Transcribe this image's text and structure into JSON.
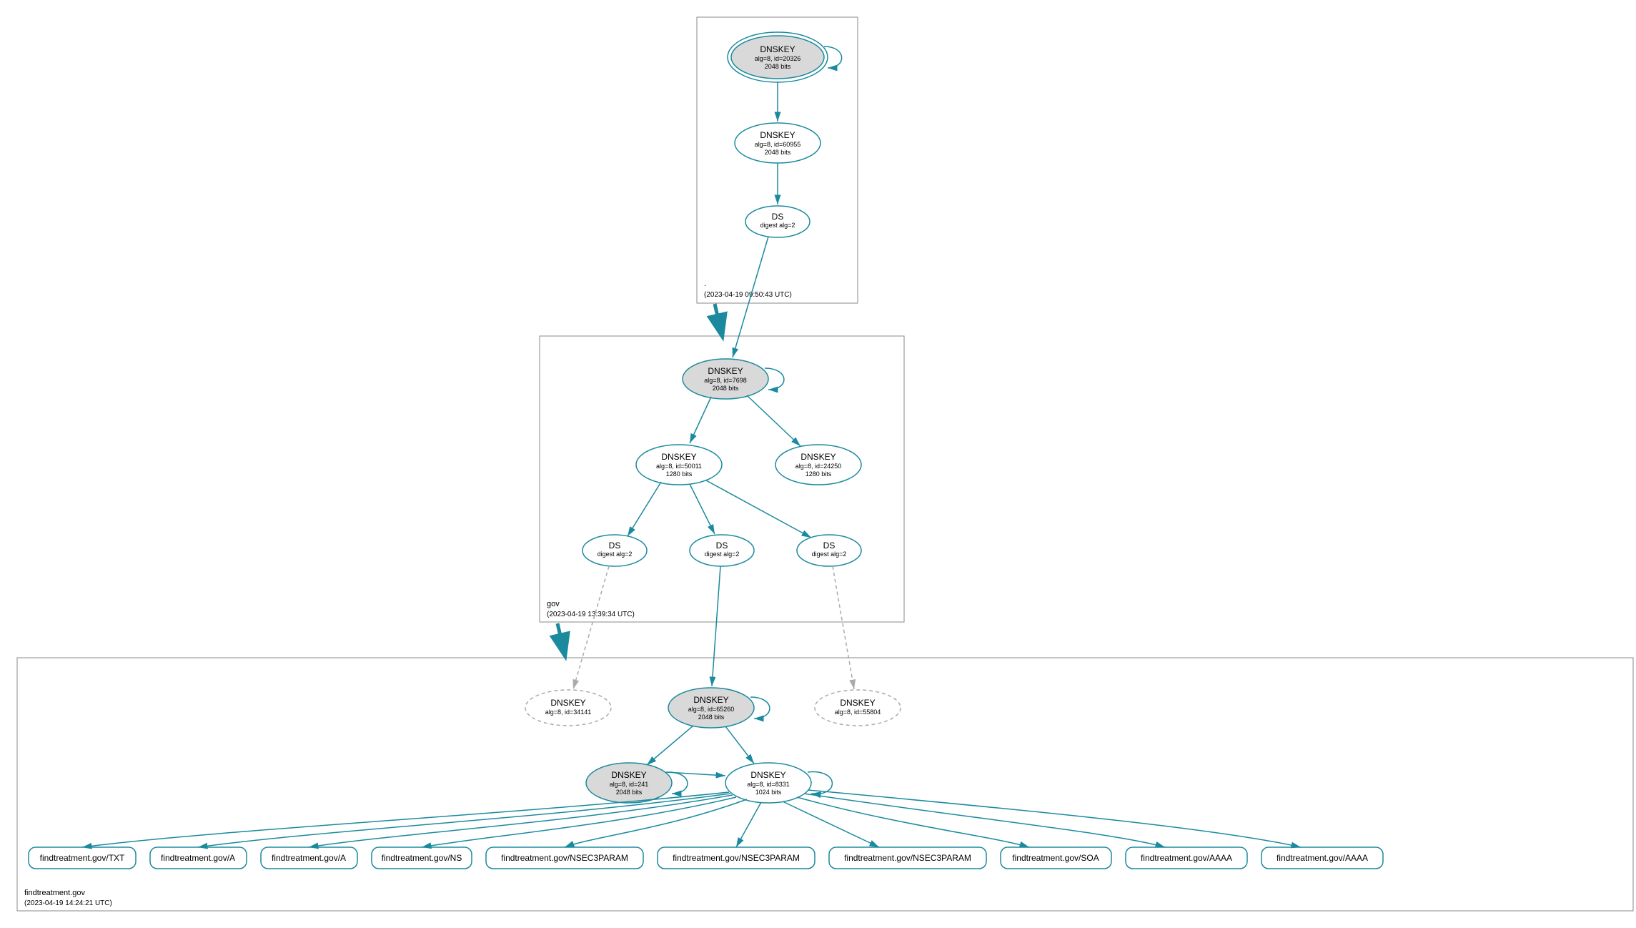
{
  "zones": {
    "root": {
      "name": ".",
      "timestamp": "(2023-04-19 09:50:43 UTC)"
    },
    "gov": {
      "name": "gov",
      "timestamp": "(2023-04-19 13:39:34 UTC)"
    },
    "findtreatment": {
      "name": "findtreatment.gov",
      "timestamp": "(2023-04-19 14:24:21 UTC)"
    }
  },
  "nodes": {
    "root_ksk": {
      "title": "DNSKEY",
      "sub1": "alg=8, id=20326",
      "sub2": "2048 bits"
    },
    "root_zsk": {
      "title": "DNSKEY",
      "sub1": "alg=8, id=60955",
      "sub2": "2048 bits"
    },
    "root_ds": {
      "title": "DS",
      "sub1": "digest alg=2"
    },
    "gov_ksk": {
      "title": "DNSKEY",
      "sub1": "alg=8, id=7698",
      "sub2": "2048 bits"
    },
    "gov_zsk1": {
      "title": "DNSKEY",
      "sub1": "alg=8, id=50011",
      "sub2": "1280 bits"
    },
    "gov_zsk2": {
      "title": "DNSKEY",
      "sub1": "alg=8, id=24250",
      "sub2": "1280 bits"
    },
    "gov_ds1": {
      "title": "DS",
      "sub1": "digest alg=2"
    },
    "gov_ds2": {
      "title": "DS",
      "sub1": "digest alg=2"
    },
    "gov_ds3": {
      "title": "DS",
      "sub1": "digest alg=2"
    },
    "ft_dash1": {
      "title": "DNSKEY",
      "sub1": "alg=8, id=34141"
    },
    "ft_ksk": {
      "title": "DNSKEY",
      "sub1": "alg=8, id=65260",
      "sub2": "2048 bits"
    },
    "ft_dash2": {
      "title": "DNSKEY",
      "sub1": "alg=8, id=55804"
    },
    "ft_key2": {
      "title": "DNSKEY",
      "sub1": "alg=8, id=241",
      "sub2": "2048 bits"
    },
    "ft_zsk": {
      "title": "DNSKEY",
      "sub1": "alg=8, id=8331",
      "sub2": "1024 bits"
    }
  },
  "rrsets": [
    "findtreatment.gov/TXT",
    "findtreatment.gov/A",
    "findtreatment.gov/A",
    "findtreatment.gov/NS",
    "findtreatment.gov/NSEC3PARAM",
    "findtreatment.gov/NSEC3PARAM",
    "findtreatment.gov/NSEC3PARAM",
    "findtreatment.gov/SOA",
    "findtreatment.gov/AAAA",
    "findtreatment.gov/AAAA"
  ]
}
